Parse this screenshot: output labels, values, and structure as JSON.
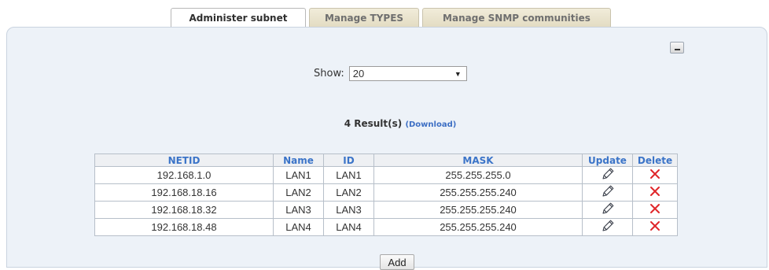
{
  "tabs": [
    {
      "label": "Administer subnet",
      "active": true
    },
    {
      "label": "Manage TYPES",
      "active": false
    },
    {
      "label": "Manage SNMP communities",
      "active": false
    }
  ],
  "show": {
    "label": "Show:",
    "selected": "20"
  },
  "results": {
    "text": "4 Result(s)",
    "download": "(Download)"
  },
  "table": {
    "headers": [
      "NETID",
      "Name",
      "ID",
      "MASK",
      "Update",
      "Delete"
    ],
    "rows": [
      {
        "netid": "192.168.1.0",
        "name": "LAN1",
        "id": "LAN1",
        "mask": "255.255.255.0"
      },
      {
        "netid": "192.168.18.16",
        "name": "LAN2",
        "id": "LAN2",
        "mask": "255.255.255.240"
      },
      {
        "netid": "192.168.18.32",
        "name": "LAN3",
        "id": "LAN3",
        "mask": "255.255.255.240"
      },
      {
        "netid": "192.168.18.48",
        "name": "LAN4",
        "id": "LAN4",
        "mask": "255.255.255.240"
      }
    ]
  },
  "add_label": "Add",
  "icons": {
    "update": "pencil-icon",
    "delete": "red-x-icon",
    "collapse": "minimize-icon"
  },
  "colors": {
    "header_text": "#3b74c8",
    "link": "#3d6fc4",
    "delete": "#e0262a",
    "panel": "#edf2f8"
  }
}
